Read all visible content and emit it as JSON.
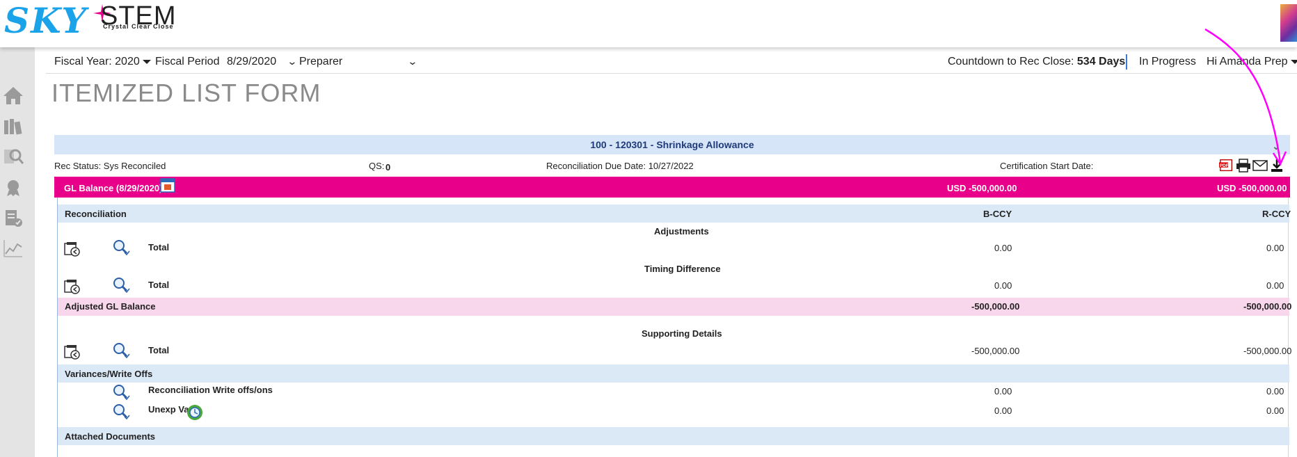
{
  "logo": {
    "sky": "SKY",
    "stem": "STEM",
    "tagline": "Crystal Clear Close"
  },
  "filters": {
    "fiscal_year_label": "Fiscal Year: 2020",
    "fiscal_period_label": "Fiscal Period",
    "fiscal_period_value": "8/29/2020",
    "role_value": "Preparer",
    "countdown_label": "Countdown to Rec Close:",
    "countdown_value": "534 Days",
    "status": "In Progress",
    "greeting": "Hi Amanda Prep"
  },
  "page_title": "ITEMIZED LIST FORM",
  "account": {
    "header": "100 - 120301 - Shrinkage Allowance",
    "rec_status": "Rec Status: Sys Reconciled",
    "qs_label": "QS:",
    "qs_value": "0",
    "due_date": "Reconciliation Due Date: 10/27/2022",
    "cert_start": "Certification Start Date:"
  },
  "gl_balance": {
    "label": "GL Balance (8/29/2020)",
    "bccy": "USD -500,000.00",
    "rccy": "USD -500,000.00"
  },
  "reconciliation": {
    "label": "Reconciliation",
    "col_bccy": "B-CCY",
    "col_rccy": "R-CCY"
  },
  "sections": {
    "adjustments": {
      "title": "Adjustments",
      "total_label": "Total",
      "bccy": "0.00",
      "rccy": "0.00"
    },
    "timing": {
      "title": "Timing Difference",
      "total_label": "Total",
      "bccy": "0.00",
      "rccy": "0.00"
    },
    "adjusted": {
      "label": "Adjusted GL Balance",
      "bccy": "-500,000.00",
      "rccy": "-500,000.00"
    },
    "supporting": {
      "title": "Supporting Details",
      "total_label": "Total",
      "bccy": "-500,000.00",
      "rccy": "-500,000.00"
    },
    "variances": {
      "label": "Variances/Write Offs",
      "writeoffs_label": "Reconciliation Write offs/ons",
      "writeoffs_bccy": "0.00",
      "writeoffs_rccy": "0.00",
      "unexp_label": "Unexp Var",
      "unexp_bccy": "0.00",
      "unexp_rccy": "0.00"
    },
    "attached": {
      "label": "Attached Documents"
    }
  },
  "colors": {
    "accent_pink": "#e8008a",
    "header_blue": "#d6e6f8",
    "row_pink": "#f8d7ec",
    "logo_blue": "#1aa3e8"
  }
}
